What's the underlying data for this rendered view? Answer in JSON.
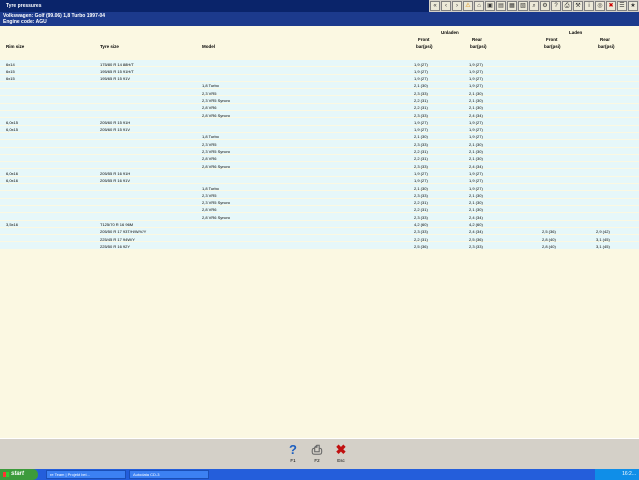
{
  "window": {
    "title": "Tyre pressures"
  },
  "toolbar": {
    "icons": [
      "back-icon",
      "prev-icon",
      "next-icon",
      "warning-icon",
      "home-icon",
      "car-icon",
      "book-icon",
      "folder-icon",
      "chart-icon",
      "search-icon",
      "settings-icon",
      "help-icon",
      "print-icon",
      "tools-icon",
      "info-icon",
      "globe-icon",
      "close-icon",
      "list-icon",
      "star-icon"
    ]
  },
  "header": {
    "vehicle": "Volkswagen:  Golf (99.06) 1,8 Turbo 1997-04",
    "engine": "Engine code: AGU"
  },
  "columns": {
    "rim_size": "Rim size",
    "tyre_size": "Tyre size",
    "model": "Model",
    "unladen": "Unladen",
    "laden": "Laden",
    "front": "Front",
    "rear": "Rear",
    "unit": "bar(psi)"
  },
  "rows": [
    {
      "rim": "6x14",
      "tyre": "175/80 R 14 88H/T",
      "model": "",
      "uf": "1,9 (27)",
      "ur": "1,9 (27)",
      "lf": "",
      "lr": ""
    },
    {
      "rim": "6x15",
      "tyre": "195/65 R 15 91H/T",
      "model": "",
      "uf": "1,9 (27)",
      "ur": "1,9 (27)",
      "lf": "",
      "lr": ""
    },
    {
      "rim": "6x15",
      "tyre": "195/65 R 15 91V",
      "model": "",
      "uf": "1,9 (27)",
      "ur": "1,9 (27)",
      "lf": "",
      "lr": ""
    },
    {
      "rim": "",
      "tyre": "",
      "model": "1,8 Turbo",
      "uf": "2,1 (30)",
      "ur": "1,9 (27)",
      "lf": "",
      "lr": ""
    },
    {
      "rim": "",
      "tyre": "",
      "model": "2,3 VR5",
      "uf": "2,3 (33)",
      "ur": "2,1 (30)",
      "lf": "",
      "lr": ""
    },
    {
      "rim": "",
      "tyre": "",
      "model": "2,3 VR5 Syncro",
      "uf": "2,2 (31)",
      "ur": "2,1 (30)",
      "lf": "",
      "lr": ""
    },
    {
      "rim": "",
      "tyre": "",
      "model": "2,8 VR6",
      "uf": "2,2 (31)",
      "ur": "2,1 (30)",
      "lf": "",
      "lr": ""
    },
    {
      "rim": "",
      "tyre": "",
      "model": "2,8 VR6 Syncro",
      "uf": "2,3 (33)",
      "ur": "2,4 (34)",
      "lf": "",
      "lr": ""
    },
    {
      "rim": "6,0x15",
      "tyre": "205/60 R 15 91H",
      "model": "",
      "uf": "1,9 (27)",
      "ur": "1,9 (27)",
      "lf": "",
      "lr": ""
    },
    {
      "rim": "6,0x15",
      "tyre": "205/60 R 15 91V",
      "model": "",
      "uf": "1,9 (27)",
      "ur": "1,9 (27)",
      "lf": "",
      "lr": ""
    },
    {
      "rim": "",
      "tyre": "",
      "model": "1,8 Turbo",
      "uf": "2,1 (30)",
      "ur": "1,9 (27)",
      "lf": "",
      "lr": ""
    },
    {
      "rim": "",
      "tyre": "",
      "model": "2,3 VR5",
      "uf": "2,3 (33)",
      "ur": "2,1 (30)",
      "lf": "",
      "lr": ""
    },
    {
      "rim": "",
      "tyre": "",
      "model": "2,3 VR5 Syncro",
      "uf": "2,2 (31)",
      "ur": "2,1 (30)",
      "lf": "",
      "lr": ""
    },
    {
      "rim": "",
      "tyre": "",
      "model": "2,8 VR6",
      "uf": "2,2 (31)",
      "ur": "2,1 (30)",
      "lf": "",
      "lr": ""
    },
    {
      "rim": "",
      "tyre": "",
      "model": "2,8 VR6 Syncro",
      "uf": "2,3 (33)",
      "ur": "2,4 (34)",
      "lf": "",
      "lr": ""
    },
    {
      "rim": "6,0x16",
      "tyre": "205/55 R 16 91H",
      "model": "",
      "uf": "1,9 (27)",
      "ur": "1,9 (27)",
      "lf": "",
      "lr": ""
    },
    {
      "rim": "6,0x16",
      "tyre": "205/55 R 16 91V",
      "model": "",
      "uf": "1,9 (27)",
      "ur": "1,9 (27)",
      "lf": "",
      "lr": ""
    },
    {
      "rim": "",
      "tyre": "",
      "model": "1,8 Turbo",
      "uf": "2,1 (30)",
      "ur": "1,9 (27)",
      "lf": "",
      "lr": ""
    },
    {
      "rim": "",
      "tyre": "",
      "model": "2,3 VR5",
      "uf": "2,3 (33)",
      "ur": "2,1 (30)",
      "lf": "",
      "lr": ""
    },
    {
      "rim": "",
      "tyre": "",
      "model": "2,3 VR5 Syncro",
      "uf": "2,2 (31)",
      "ur": "2,1 (30)",
      "lf": "",
      "lr": ""
    },
    {
      "rim": "",
      "tyre": "",
      "model": "2,8 VR6",
      "uf": "2,2 (31)",
      "ur": "2,1 (30)",
      "lf": "",
      "lr": ""
    },
    {
      "rim": "",
      "tyre": "",
      "model": "2,8 VR6 Syncro",
      "uf": "2,3 (33)",
      "ur": "2,4 (34)",
      "lf": "",
      "lr": ""
    },
    {
      "rim": "3,5x16",
      "tyre": "T125/70 R 16 96M",
      "model": "",
      "uf": "4,2 (60)",
      "ur": "4,2 (60)",
      "lf": "",
      "lr": ""
    },
    {
      "rim": "",
      "tyre": "205/50 R 17 93T/H/W/V/Y",
      "model": "",
      "uf": "2,3 (33)",
      "ur": "2,4 (34)",
      "lf": "2,5 (36)",
      "lr": "2,9 (42)"
    },
    {
      "rim": "",
      "tyre": "225/45 R 17 94W/Y",
      "model": "",
      "uf": "2,2 (31)",
      "ur": "2,5 (36)",
      "lf": "2,8 (40)",
      "lr": "3,1 (45)"
    },
    {
      "rim": "",
      "tyre": "225/50 R 16 92Y",
      "model": "",
      "uf": "2,5 (36)",
      "ur": "2,3 (33)",
      "lf": "2,8 (40)",
      "lr": "3,1 (45)"
    }
  ],
  "functions": [
    {
      "label": "F1",
      "icon": "help-icon"
    },
    {
      "label": "F2",
      "icon": "print-icon"
    },
    {
      "label": "Esc",
      "icon": "close-icon"
    }
  ],
  "taskbar": {
    "start": "start",
    "tasks": [
      "re Team | Projekt bei...",
      "Autodata CD-3"
    ],
    "clock": "16:2..."
  },
  "colors": {
    "title_bg": "#0a246a",
    "header_bg": "#1c3a8c",
    "content_bg": "#fbf8e2",
    "row_bg": "#e6f7f9",
    "taskbar": "#245edb"
  }
}
